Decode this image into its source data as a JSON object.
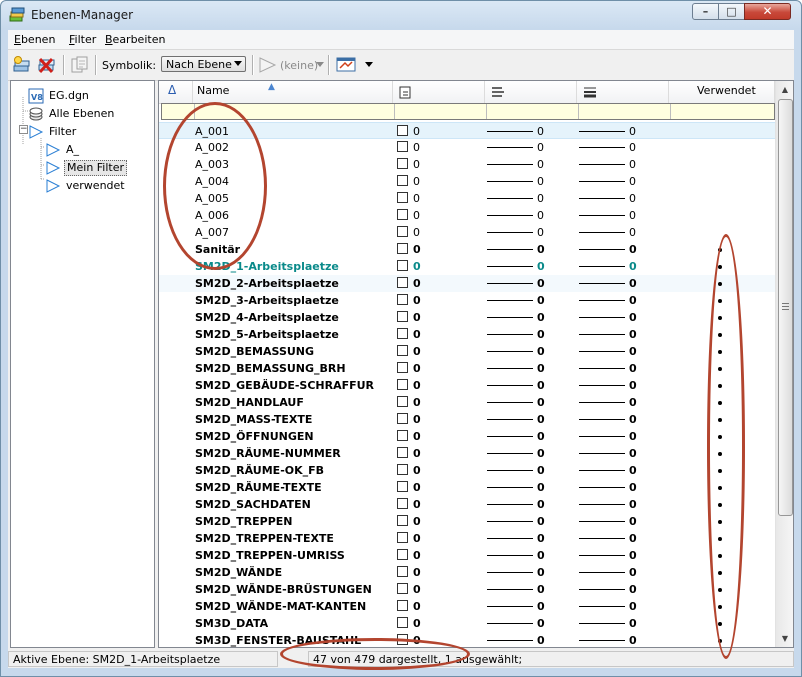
{
  "window": {
    "title": "Ebenen-Manager"
  },
  "menu": [
    "Ebenen",
    "Filter",
    "Bearbeiten"
  ],
  "toolbar": {
    "symbolik_label": "Symbolik:",
    "symbolik_value": "Nach Ebene",
    "filter_value": "(keine)"
  },
  "tree": [
    {
      "label": "EG.dgn",
      "icon": "dgn-file-icon"
    },
    {
      "label": "Alle Ebenen",
      "icon": "layers-stack-icon"
    },
    {
      "label": "Filter",
      "icon": "filter-funnel-icon"
    },
    {
      "label": "A_",
      "icon": "filter-funnel-icon"
    },
    {
      "label": "Mein Filter",
      "icon": "filter-funnel-icon"
    },
    {
      "label": "verwendet",
      "icon": "filter-funnel-icon"
    }
  ],
  "grid": {
    "headers": {
      "name": "Name",
      "verwendet": "Verwendet"
    },
    "rows": [
      {
        "name": "A_001",
        "v1": "0",
        "v2": "0",
        "v3": "0",
        "used": false
      },
      {
        "name": "A_002",
        "v1": "0",
        "v2": "0",
        "v3": "0",
        "used": false
      },
      {
        "name": "A_003",
        "v1": "0",
        "v2": "0",
        "v3": "0",
        "used": false
      },
      {
        "name": "A_004",
        "v1": "0",
        "v2": "0",
        "v3": "0",
        "used": false
      },
      {
        "name": "A_005",
        "v1": "0",
        "v2": "0",
        "v3": "0",
        "used": false
      },
      {
        "name": "A_006",
        "v1": "0",
        "v2": "0",
        "v3": "0",
        "used": false
      },
      {
        "name": "A_007",
        "v1": "0",
        "v2": "0",
        "v3": "0",
        "used": false
      },
      {
        "name": "Sanitär",
        "v1": "0",
        "v2": "0",
        "v3": "0",
        "used": true
      },
      {
        "name": "SM2D_1-Arbeitsplaetze",
        "v1": "0",
        "v2": "0",
        "v3": "0",
        "used": true
      },
      {
        "name": "SM2D_2-Arbeitsplaetze",
        "v1": "0",
        "v2": "0",
        "v3": "0",
        "used": true
      },
      {
        "name": "SM2D_3-Arbeitsplaetze",
        "v1": "0",
        "v2": "0",
        "v3": "0",
        "used": true
      },
      {
        "name": "SM2D_4-Arbeitsplaetze",
        "v1": "0",
        "v2": "0",
        "v3": "0",
        "used": true
      },
      {
        "name": "SM2D_5-Arbeitsplaetze",
        "v1": "0",
        "v2": "0",
        "v3": "0",
        "used": true
      },
      {
        "name": "SM2D_BEMASSUNG",
        "v1": "0",
        "v2": "0",
        "v3": "0",
        "used": true
      },
      {
        "name": "SM2D_BEMASSUNG_BRH",
        "v1": "0",
        "v2": "0",
        "v3": "0",
        "used": true
      },
      {
        "name": "SM2D_GEBÄUDE-SCHRAFFUR",
        "v1": "0",
        "v2": "0",
        "v3": "0",
        "used": true
      },
      {
        "name": "SM2D_HANDLAUF",
        "v1": "0",
        "v2": "0",
        "v3": "0",
        "used": true
      },
      {
        "name": "SM2D_MASS-TEXTE",
        "v1": "0",
        "v2": "0",
        "v3": "0",
        "used": true
      },
      {
        "name": "SM2D_ÖFFNUNGEN",
        "v1": "0",
        "v2": "0",
        "v3": "0",
        "used": true
      },
      {
        "name": "SM2D_RÄUME-NUMMER",
        "v1": "0",
        "v2": "0",
        "v3": "0",
        "used": true
      },
      {
        "name": "SM2D_RÄUME-OK_FB",
        "v1": "0",
        "v2": "0",
        "v3": "0",
        "used": true
      },
      {
        "name": "SM2D_RÄUME-TEXTE",
        "v1": "0",
        "v2": "0",
        "v3": "0",
        "used": true
      },
      {
        "name": "SM2D_SACHDATEN",
        "v1": "0",
        "v2": "0",
        "v3": "0",
        "used": true
      },
      {
        "name": "SM2D_TREPPEN",
        "v1": "0",
        "v2": "0",
        "v3": "0",
        "used": true
      },
      {
        "name": "SM2D_TREPPEN-TEXTE",
        "v1": "0",
        "v2": "0",
        "v3": "0",
        "used": true
      },
      {
        "name": "SM2D_TREPPEN-UMRISS",
        "v1": "0",
        "v2": "0",
        "v3": "0",
        "used": true
      },
      {
        "name": "SM2D_WÄNDE",
        "v1": "0",
        "v2": "0",
        "v3": "0",
        "used": true
      },
      {
        "name": "SM2D_WÄNDE-BRÜSTUNGEN",
        "v1": "0",
        "v2": "0",
        "v3": "0",
        "used": true
      },
      {
        "name": "SM2D_WÄNDE-MAT-KANTEN",
        "v1": "0",
        "v2": "0",
        "v3": "0",
        "used": true
      },
      {
        "name": "SM3D_DATA",
        "v1": "0",
        "v2": "0",
        "v3": "0",
        "used": true
      },
      {
        "name": "SM3D_FENSTER-BAUSTAHL",
        "v1": "0",
        "v2": "0",
        "v3": "0",
        "used": true
      }
    ]
  },
  "status": {
    "active_layer": "Aktive Ebene: SM2D_1-Arbeitsplaetze",
    "count": "47 von 479 dargestellt, 1 ausgewählt;"
  },
  "colors": {
    "active_row_text": "#0a8a8a",
    "annotation": "#b3452f",
    "selection": "#e5f3fb"
  }
}
